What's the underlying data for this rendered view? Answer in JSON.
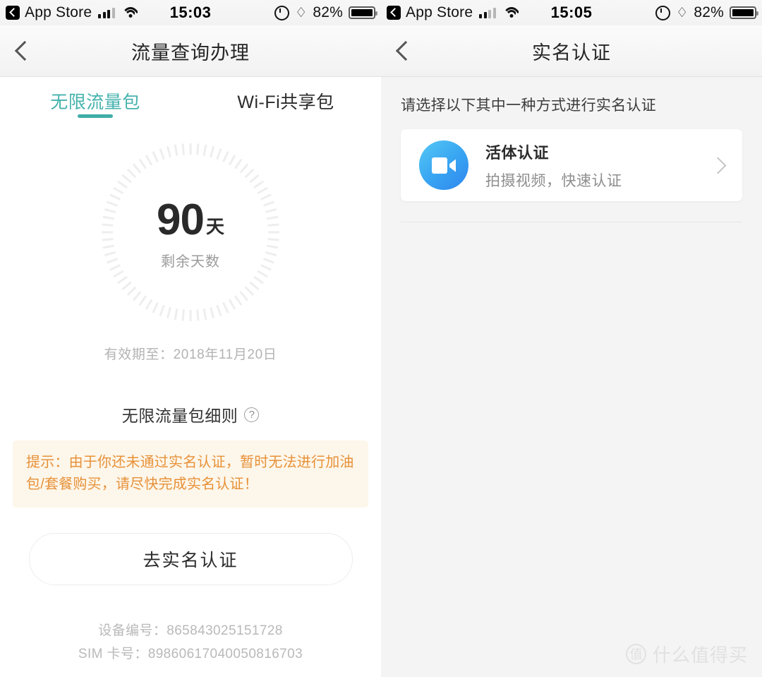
{
  "left": {
    "status_bar": {
      "carrier_back_label": "App Store",
      "time": "15:03",
      "battery_percent": "82%",
      "signal_icon": "signal-bars-icon",
      "wifi_icon": "wifi-icon",
      "alarm_icon": "alarm-clock-icon",
      "bluetooth_icon": "bluetooth-icon",
      "battery_icon": "battery-icon"
    },
    "nav": {
      "back_icon": "chevron-left-icon",
      "title": "流量查询办理"
    },
    "tabs": [
      {
        "label": "无限流量包",
        "active": true
      },
      {
        "label": "Wi-Fi共享包",
        "active": false
      }
    ],
    "dial": {
      "value": "90",
      "unit": "天",
      "caption": "剩余天数",
      "tick_color": "#eeeeee"
    },
    "expiry": "有效期至：2018年11月20日",
    "detail": {
      "title": "无限流量包细则",
      "help_icon": "question-mark-icon"
    },
    "warning": {
      "text": "提示：由于你还未通过实名认证，暂时无法进行加油包/套餐购买，请尽快完成实名认证！",
      "text_color": "#e79138",
      "background_color": "#fdf6ea"
    },
    "cta_label": "去实名认证",
    "meta": {
      "device_label": "设备编号：",
      "device_value": "865843025151728",
      "sim_label": "SIM 卡号：",
      "sim_value": "89860617040050816703"
    },
    "accent_color": "#3fada8"
  },
  "right": {
    "status_bar": {
      "carrier_back_label": "App Store",
      "time": "15:05",
      "battery_percent": "82%",
      "signal_icon": "signal-bars-icon",
      "wifi_icon": "wifi-icon",
      "alarm_icon": "alarm-clock-icon",
      "bluetooth_icon": "bluetooth-icon",
      "battery_icon": "battery-icon"
    },
    "nav": {
      "back_icon": "chevron-left-icon",
      "title": "实名认证"
    },
    "hint": "请选择以下其中一种方式进行实名认证",
    "options": [
      {
        "icon": "video-camera-icon",
        "title": "活体认证",
        "subtitle": "拍摄视频，快速认证",
        "chevron_icon": "chevron-right-icon",
        "icon_color": "#38a5f2"
      }
    ],
    "watermark": {
      "badge": "值",
      "text": "什么值得买"
    }
  }
}
